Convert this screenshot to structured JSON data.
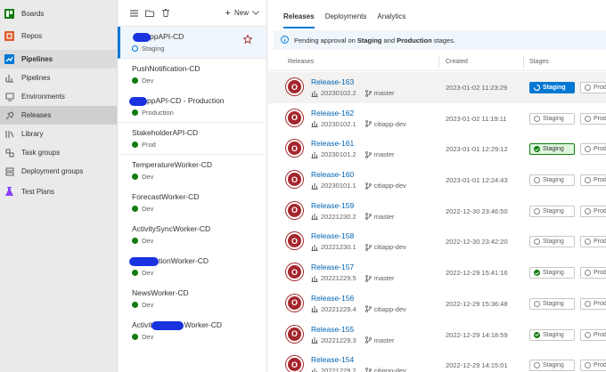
{
  "nav": {
    "items": [
      {
        "label": "Boards",
        "icon": "boards-icon"
      },
      {
        "label": "Repos",
        "icon": "repos-icon"
      },
      {
        "label": "Pipelines",
        "icon": "pipelines-icon"
      },
      {
        "label": "Pipelines",
        "icon": "pipeline-sub-icon"
      },
      {
        "label": "Environments",
        "icon": "environments-icon"
      },
      {
        "label": "Releases",
        "icon": "releases-icon"
      },
      {
        "label": "Library",
        "icon": "library-icon"
      },
      {
        "label": "Task groups",
        "icon": "task-groups-icon"
      },
      {
        "label": "Deployment groups",
        "icon": "deployment-groups-icon"
      },
      {
        "label": "Test Plans",
        "icon": "test-plans-icon"
      }
    ]
  },
  "defs": {
    "new_label": "New",
    "items": [
      {
        "name": "ppAPI-CD",
        "env": "Staging",
        "status": "pending"
      },
      {
        "name": "PushNotification-CD",
        "env": "Dev",
        "status": "ok"
      },
      {
        "name": "ppAPI-CD - Production",
        "env": "Production",
        "status": "ok"
      },
      {
        "name": "StakeholderAPI-CD",
        "env": "Prod",
        "status": "ok"
      },
      {
        "name": "TemperatureWorker-CD",
        "env": "Dev",
        "status": "ok"
      },
      {
        "name": "ForecastWorker-CD",
        "env": "Dev",
        "status": "ok"
      },
      {
        "name": "ActivitySyncWorker-CD",
        "env": "Dev",
        "status": "ok"
      },
      {
        "name": "tionWorker-CD",
        "env": "Dev",
        "status": "ok"
      },
      {
        "name": "NewsWorker-CD",
        "env": "Dev",
        "status": "ok"
      },
      {
        "name_a": "Activit",
        "name_b": "Worker-CD",
        "env": "Dev",
        "status": "ok"
      }
    ]
  },
  "main": {
    "tabs": [
      "Releases",
      "Deployments",
      "Analytics"
    ],
    "banner": {
      "pre": "Pending approval on ",
      "s1": "Staging",
      "mid": " and ",
      "s2": "Production",
      "post": " stages."
    },
    "columns": {
      "releases": "Releases",
      "created": "Created",
      "stages": "Stages"
    },
    "rows": [
      {
        "name": "Release-163",
        "build": "20230102.2",
        "branch": "master",
        "created": "2023-01-02 11:23:29",
        "s1": "Staging",
        "s1_state": "inprogress",
        "s2": "Produ"
      },
      {
        "name": "Release-162",
        "build": "20230102.1",
        "branch": "citiapp-dev",
        "created": "2023-01-02 11:19:11",
        "s1": "Staging",
        "s1_state": "none",
        "s2": "Produ"
      },
      {
        "name": "Release-161",
        "build": "20230101.2",
        "branch": "master",
        "created": "2023-01-01 12:29:12",
        "s1": "Staging",
        "s1_state": "succeeded",
        "s2": "Produ"
      },
      {
        "name": "Release-160",
        "build": "20230101.1",
        "branch": "citiapp-dev",
        "created": "2023-01-01 12:24:43",
        "s1": "Staging",
        "s1_state": "none",
        "s2": "Produ"
      },
      {
        "name": "Release-159",
        "build": "20221230.2",
        "branch": "master",
        "created": "2022-12-30 23:46:50",
        "s1": "Staging",
        "s1_state": "none",
        "s2": "Produ"
      },
      {
        "name": "Release-158",
        "build": "20221230.1",
        "branch": "citiapp-dev",
        "created": "2022-12-30 23:42:20",
        "s1": "Staging",
        "s1_state": "none",
        "s2": "Produ"
      },
      {
        "name": "Release-157",
        "build": "20221229.5",
        "branch": "master",
        "created": "2022-12-29 15:41:16",
        "s1": "Staging",
        "s1_state": "okdot",
        "s2": "Produ"
      },
      {
        "name": "Release-156",
        "build": "20221229.4",
        "branch": "citiapp-dev",
        "created": "2022-12-29 15:36:48",
        "s1": "Staging",
        "s1_state": "none",
        "s2": "Produ"
      },
      {
        "name": "Release-155",
        "build": "20221229.3",
        "branch": "master",
        "created": "2022-12-29 14:18:59",
        "s1": "Staging",
        "s1_state": "okdot",
        "s2": "Produ"
      },
      {
        "name": "Release-154",
        "build": "20221229.2",
        "branch": "citiapp-dev",
        "created": "2022-12-29 14:15:01",
        "s1": "Staging",
        "s1_state": "none",
        "s2": "Produ"
      }
    ]
  },
  "colors": {
    "accent": "#0078d4",
    "success": "#107c10",
    "release_icon": "#a4262c",
    "redaction": "#1a33e0"
  }
}
